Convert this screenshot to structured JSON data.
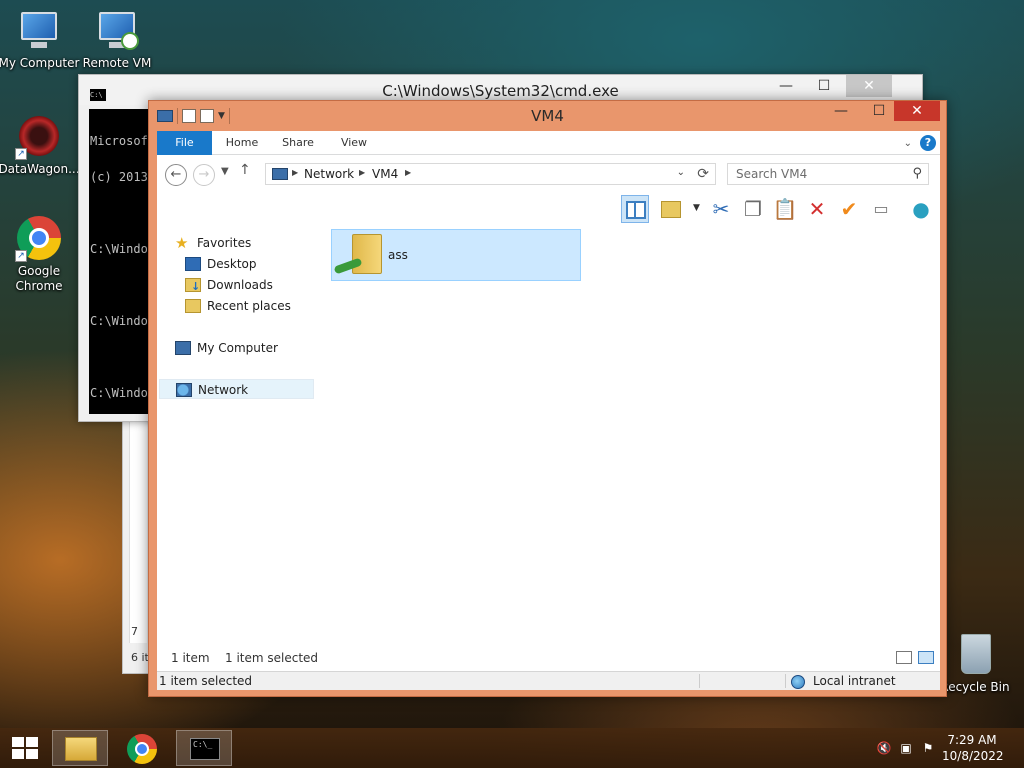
{
  "desktop": {
    "icons": [
      {
        "label": "My Computer"
      },
      {
        "label": "Remote VM"
      },
      {
        "label": "DataWagon..."
      },
      {
        "label": "Google Chrome"
      },
      {
        "label": "Recycle Bin"
      }
    ]
  },
  "cmd_window": {
    "title": "C:\\Windows\\System32\\cmd.exe",
    "icon_text": "C:\\",
    "lines": [
      "Microsof",
      "(c) 2013",
      "",
      "C:\\Windo",
      "",
      "C:\\Windo",
      "",
      "C:\\Windo"
    ],
    "min_glyph": "—",
    "max_glyph": "☐",
    "close_glyph": "✕"
  },
  "background_window": {
    "text_a": "7",
    "text_b": "6 it"
  },
  "explorer": {
    "title": "VM4",
    "min_glyph": "—",
    "max_glyph": "☐",
    "close_glyph": "✕",
    "ribbon_tabs": [
      "File",
      "Home",
      "Share",
      "View"
    ],
    "help_glyph": "?",
    "chevron_glyph": "⌄",
    "address": {
      "crumbs": [
        "Network",
        "VM4"
      ],
      "separator": "▶"
    },
    "search_placeholder": "Search VM4",
    "navigation": {
      "favorites": "Favorites",
      "desktop": "Desktop",
      "downloads": "Downloads",
      "recent": "Recent places",
      "computer": "My Computer",
      "network": "Network"
    },
    "files": [
      {
        "name": "ass",
        "type": "network-folder",
        "selected": true
      }
    ],
    "status": {
      "item_count": "1 item",
      "selected": "1 item selected",
      "bar_left": "1 item selected",
      "zone": "Local intranet"
    }
  },
  "taskbar": {
    "tasks": [
      "file-explorer",
      "google-chrome",
      "command-prompt"
    ],
    "cmd_icon_text": "C:\\_",
    "time": "7:29 AM",
    "date": "10/8/2022"
  },
  "colors": {
    "explorer_frame": "#e9966c",
    "file_tab": "#1979ca",
    "selection": "#cce8ff",
    "close_button": "#c7362a"
  }
}
